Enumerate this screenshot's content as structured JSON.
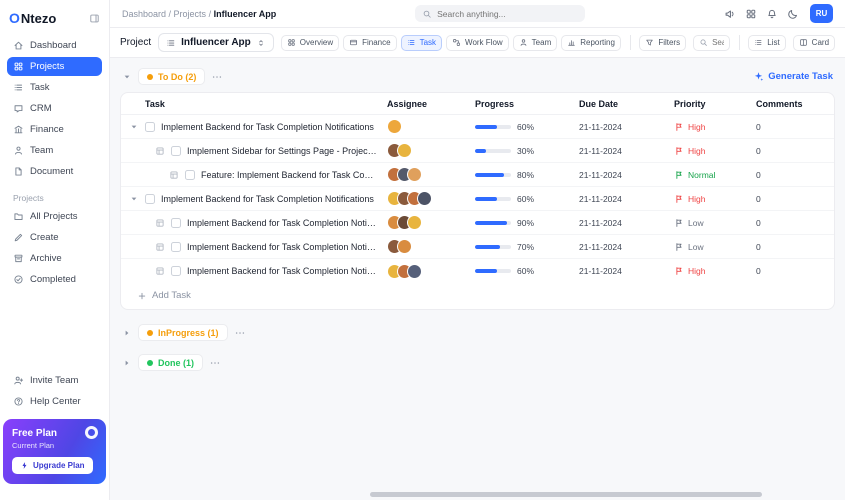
{
  "colors": {
    "accent": "#2f6bff",
    "priority_high": "#ef4444",
    "priority_normal": "#16a34a",
    "priority_low": "#6b7280"
  },
  "app": {
    "logo_prefix": "O",
    "logo_suffix": "Ntezo"
  },
  "header": {
    "breadcrumb": [
      "Dashboard",
      "Projects",
      "Influencer App"
    ],
    "search_placeholder": "Search anything...",
    "avatar_initials": "RU"
  },
  "sidebar": {
    "nav": [
      {
        "label": "Dashboard",
        "icon": "home"
      },
      {
        "label": "Projects",
        "icon": "grid",
        "active": true
      },
      {
        "label": "Task",
        "icon": "list"
      },
      {
        "label": "CRM",
        "icon": "chat"
      },
      {
        "label": "Finance",
        "icon": "bank"
      },
      {
        "label": "Team",
        "icon": "user"
      },
      {
        "label": "Document",
        "icon": "doc"
      }
    ],
    "section_label": "Projects",
    "project_nav": [
      {
        "label": "All Projects",
        "icon": "folder"
      },
      {
        "label": "Create",
        "icon": "pencil"
      },
      {
        "label": "Archive",
        "icon": "archive"
      },
      {
        "label": "Completed",
        "icon": "check-circle"
      }
    ],
    "footer_nav": [
      {
        "label": "Invite Team",
        "icon": "user-plus"
      },
      {
        "label": "Help Center",
        "icon": "help"
      }
    ],
    "plan": {
      "title": "Free Plan",
      "subtitle": "Current Plan",
      "button": "Upgrade Plan"
    }
  },
  "toolbar": {
    "project_label": "Project",
    "project_name": "Influencer App",
    "tabs": [
      {
        "label": "Overview",
        "icon": "grid"
      },
      {
        "label": "Finance",
        "icon": "card"
      },
      {
        "label": "Task",
        "icon": "list",
        "active": true
      },
      {
        "label": "Work Flow",
        "icon": "workflow"
      },
      {
        "label": "Team",
        "icon": "user"
      },
      {
        "label": "Reporting",
        "icon": "chart"
      }
    ],
    "filters_label": "Filters",
    "search_placeholder": "Search",
    "list_label": "List",
    "card_label": "Card"
  },
  "board": {
    "generate_task_label": "Generate Task",
    "add_task_label": "Add Task",
    "sections": [
      {
        "label": "To Do",
        "count": 2,
        "color": "#f59e0b",
        "state": "expanded"
      },
      {
        "label": "InProgress",
        "count": 1,
        "color": "#f59e0b",
        "state": "collapsed"
      },
      {
        "label": "Done",
        "count": 1,
        "color": "#22c55e",
        "state": "collapsed"
      }
    ],
    "table": {
      "headers": [
        "Task",
        "Assignee",
        "Progress",
        "Due Date",
        "Priority",
        "Comments"
      ],
      "rows": [
        {
          "title": "Implement Backend for Task Completion Notifications",
          "level": 0,
          "avatars": [
            "#eda73c"
          ],
          "progress": 60,
          "due_date": "21-11-2024",
          "priority": "High",
          "comments": 0
        },
        {
          "title": "Implement Sidebar for Settings Page - Project Ontezo",
          "level": 1,
          "avatars": [
            "#8a5a3c",
            "#e8b43e"
          ],
          "progress": 30,
          "due_date": "21-11-2024",
          "priority": "High",
          "comments": 0
        },
        {
          "title": "Feature: Implement Backend for Task Completion Notifications",
          "level": 2,
          "avatars": [
            "#c2703d",
            "#555a6b",
            "#e0a05c"
          ],
          "progress": 80,
          "due_date": "21-11-2024",
          "priority": "Normal",
          "comments": 0
        },
        {
          "title": "Implement Backend for Task Completion Notifications",
          "level": 0,
          "avatars": [
            "#e8b43e",
            "#8a5a3c",
            "#c2703d",
            "#4c5366"
          ],
          "progress": 60,
          "due_date": "21-11-2024",
          "priority": "High",
          "comments": 0
        },
        {
          "title": "Implement Backend for Task Completion Notifications",
          "level": 1,
          "avatars": [
            "#d98c3f",
            "#6b4a36",
            "#e8b43e"
          ],
          "progress": 90,
          "due_date": "21-11-2024",
          "priority": "Low",
          "comments": 0
        },
        {
          "title": "Implement Backend for Task Completion Notifications",
          "level": 1,
          "avatars": [
            "#8a5a3c",
            "#d98c3f"
          ],
          "progress": 70,
          "due_date": "21-11-2024",
          "priority": "Low",
          "comments": 0
        },
        {
          "title": "Implement Backend for Task Completion Notifications",
          "level": 1,
          "avatars": [
            "#e8b43e",
            "#c2703d",
            "#56607a"
          ],
          "progress": 60,
          "due_date": "21-11-2024",
          "priority": "High",
          "comments": 0
        }
      ]
    }
  }
}
